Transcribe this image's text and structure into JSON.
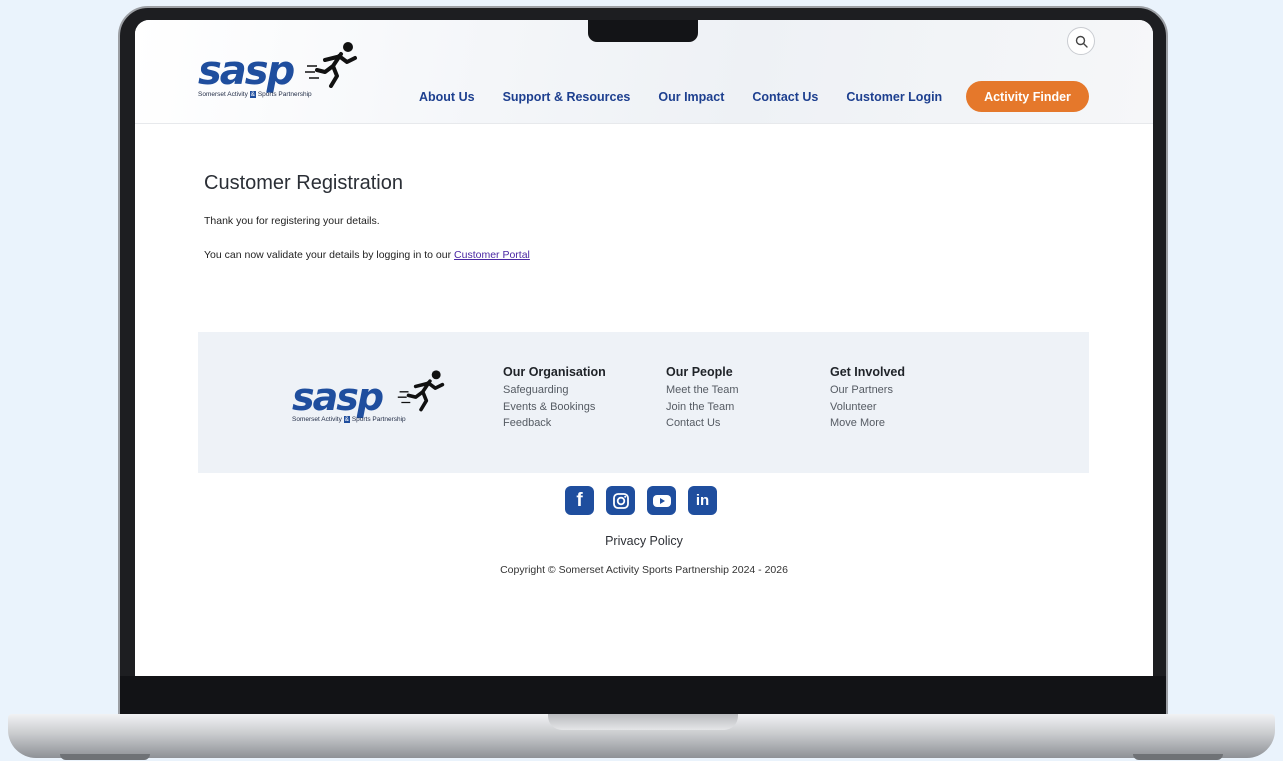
{
  "brand": {
    "wordmark": "sasp",
    "tagline_pre": "Somerset Activity",
    "tagline_amp": "&",
    "tagline_post": "Sports Partnership"
  },
  "nav": {
    "items": [
      "About Us",
      "Support & Resources",
      "Our Impact",
      "Contact Us",
      "Customer Login"
    ],
    "cta_label": "Activity Finder",
    "search_icon": "search-icon"
  },
  "main": {
    "title": "Customer Registration",
    "thanks": "Thank you for registering your details.",
    "validate_text": "You can now validate your details by logging in to our ",
    "portal_link": "Customer Portal"
  },
  "footer": {
    "columns": [
      {
        "heading": "Our Organisation",
        "links": [
          "Safeguarding",
          "Events & Bookings",
          "Feedback"
        ]
      },
      {
        "heading": "Our People",
        "links": [
          "Meet the Team",
          "Join the Team",
          "Contact Us"
        ]
      },
      {
        "heading": "Get Involved",
        "links": [
          "Our Partners",
          "Volunteer",
          "Move More"
        ]
      }
    ],
    "socials": [
      "facebook-icon",
      "instagram-icon",
      "youtube-icon",
      "linkedin-icon"
    ],
    "privacy": "Privacy Policy",
    "copyright": "Copyright © Somerset Activity Sports Partnership 2024 - 2026"
  },
  "colors": {
    "brand_blue": "#1f4e9e",
    "cta_orange": "#e5782b",
    "link_purple": "#4a27a3",
    "footer_bg": "#eef2f7",
    "page_bg": "#eaf3fc"
  }
}
